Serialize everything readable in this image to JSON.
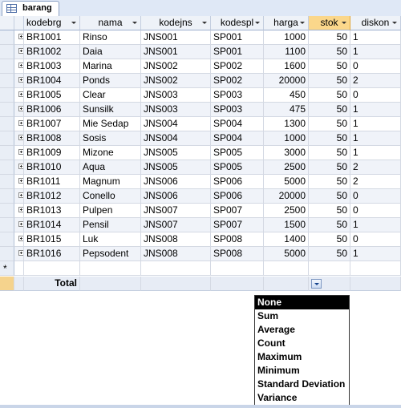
{
  "tab": {
    "label": "barang",
    "icon": "table-icon"
  },
  "columns": [
    "kodebrg",
    "nama",
    "kodejns",
    "kodespl",
    "harga",
    "stok",
    "diskon"
  ],
  "rows": [
    [
      "BR1001",
      "Rinso",
      "JNS001",
      "SP001",
      "1000",
      "50",
      "1"
    ],
    [
      "BR1002",
      "Daia",
      "JNS001",
      "SP001",
      "1100",
      "50",
      "1"
    ],
    [
      "BR1003",
      "Marina",
      "JNS002",
      "SP002",
      "1600",
      "50",
      "0"
    ],
    [
      "BR1004",
      "Ponds",
      "JNS002",
      "SP002",
      "20000",
      "50",
      "2"
    ],
    [
      "BR1005",
      "Clear",
      "JNS003",
      "SP003",
      "450",
      "50",
      "0"
    ],
    [
      "BR1006",
      "Sunsilk",
      "JNS003",
      "SP003",
      "475",
      "50",
      "1"
    ],
    [
      "BR1007",
      "Mie Sedap",
      "JNS004",
      "SP004",
      "1300",
      "50",
      "1"
    ],
    [
      "BR1008",
      "Sosis",
      "JNS004",
      "SP004",
      "1000",
      "50",
      "1"
    ],
    [
      "BR1009",
      "Mizone",
      "JNS005",
      "SP005",
      "3000",
      "50",
      "1"
    ],
    [
      "BR1010",
      "Aqua",
      "JNS005",
      "SP005",
      "2500",
      "50",
      "2"
    ],
    [
      "BR1011",
      "Magnum",
      "JNS006",
      "SP006",
      "5000",
      "50",
      "2"
    ],
    [
      "BR1012",
      "Conello",
      "JNS006",
      "SP006",
      "20000",
      "50",
      "0"
    ],
    [
      "BR1013",
      "Pulpen",
      "JNS007",
      "SP007",
      "2500",
      "50",
      "0"
    ],
    [
      "BR1014",
      "Pensil",
      "JNS007",
      "SP007",
      "1500",
      "50",
      "1"
    ],
    [
      "BR1015",
      "Luk",
      "JNS008",
      "SP008",
      "1400",
      "50",
      "0"
    ],
    [
      "BR1016",
      "Pepsodent",
      "JNS008",
      "SP008",
      "5000",
      "50",
      "1"
    ]
  ],
  "new_row_marker": "*",
  "total_label": "Total",
  "dropdown": {
    "selected": "None",
    "options": [
      "None",
      "Sum",
      "Average",
      "Count",
      "Maximum",
      "Minimum",
      "Standard Deviation",
      "Variance"
    ]
  },
  "colors": {
    "accent_header": "#fbd78b",
    "row_alt": "#f0f3f9"
  }
}
